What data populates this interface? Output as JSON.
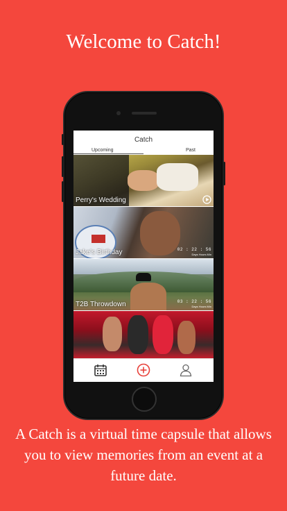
{
  "marketing": {
    "headline": "Welcome to Catch!",
    "caption": "A Catch is a virtual time capsule that allows you to view memories from an event at a future date."
  },
  "app": {
    "title": "Catch",
    "tabs": [
      {
        "label": "Upcoming",
        "selected": true
      },
      {
        "label": "Past",
        "selected": false
      }
    ],
    "events": [
      {
        "title": "Perry's Wedding",
        "indicator": "play-icon"
      },
      {
        "title": "Jake's Birthday",
        "countdown": "02 : 22 : 56",
        "countdown_label": "Days Hours Min"
      },
      {
        "title": "T2B Throwdown",
        "countdown": "03 : 22 : 56",
        "countdown_label": "Days Hours Min"
      },
      {
        "title": ""
      }
    ],
    "tabbar": [
      "calendar-icon",
      "add-circle-icon",
      "profile-icon"
    ],
    "colors": {
      "brand": "#f4473d",
      "accent": "#e8413a",
      "icon": "#333333"
    }
  }
}
